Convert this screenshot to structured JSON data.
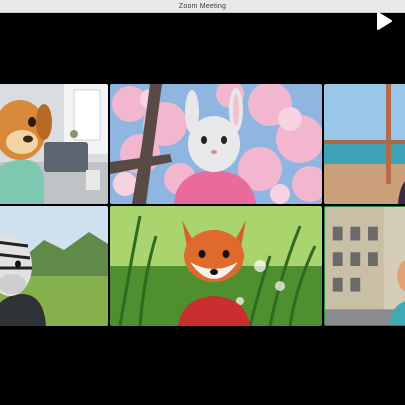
{
  "window": {
    "title": "Zoom Meeting"
  },
  "controls": {
    "play_icon": "play-icon"
  },
  "participants": [
    {
      "avatar": "dog",
      "background": "living-room"
    },
    {
      "avatar": "bunny",
      "background": "cherry-blossom"
    },
    {
      "avatar": "unknown",
      "background": "beach-window"
    },
    {
      "avatar": "zebra",
      "background": "green-hills"
    },
    {
      "avatar": "fox",
      "background": "grass"
    },
    {
      "avatar": "unknown",
      "background": "city-street"
    }
  ],
  "colors": {
    "window_bg": "#000000",
    "titlebar_bg": "#e9e9ea",
    "active_speaker_border": "#2c8a3a"
  }
}
